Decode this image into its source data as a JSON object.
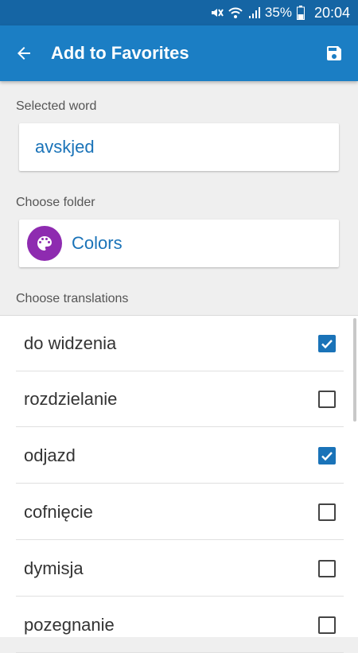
{
  "status_bar": {
    "battery": "35%",
    "time": "20:04",
    "icons": [
      "mute-icon",
      "wifi-icon",
      "signal-icon",
      "battery-icon"
    ]
  },
  "app_bar": {
    "title": "Add to Favorites",
    "back_icon": "arrow-left-icon",
    "save_icon": "save-icon"
  },
  "selected_word": {
    "label": "Selected word",
    "value": "avskjed"
  },
  "folder": {
    "label": "Choose folder",
    "name": "Colors",
    "icon": "palette-icon",
    "icon_color": "#8e2bb0"
  },
  "translations": {
    "label": "Choose translations",
    "items": [
      {
        "text": "do widzenia",
        "checked": true
      },
      {
        "text": "rozdzielanie",
        "checked": false
      },
      {
        "text": "odjazd",
        "checked": true
      },
      {
        "text": "cofnięcie",
        "checked": false
      },
      {
        "text": "dymisja",
        "checked": false
      },
      {
        "text": "pozegnanie",
        "checked": false
      }
    ]
  },
  "colors": {
    "primary": "#1b7ec4",
    "status_bar": "#1565a4",
    "accent": "#1a73b8"
  }
}
